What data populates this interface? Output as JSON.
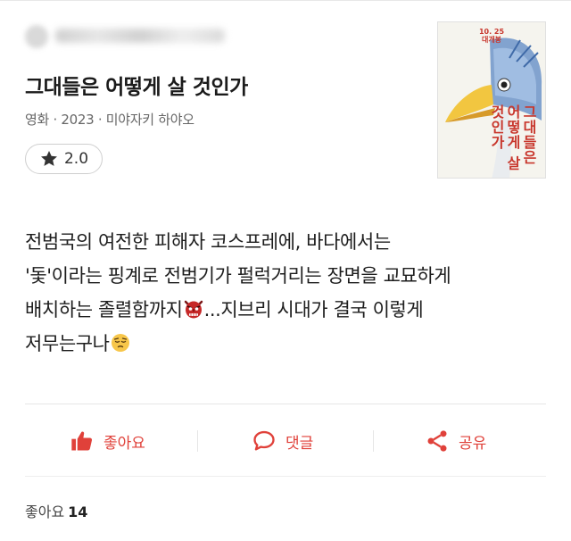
{
  "review": {
    "title": "그대들은 어떻게 살 것인가",
    "meta": "영화 · 2023 · 미야자키 하야오",
    "rating": "2.0",
    "body_lines": [
      "전범국의 여전한 피해자 코스프레에, 바다에서는",
      "'돛'이라는 핑계로 전범기가 펄럭거리는 장면을 교묘하게",
      "배치하는 졸렬함까지",
      "...지브리 시대가 결국 이렇게",
      "저무는구나"
    ],
    "poster": {
      "date_line1": "10. 25",
      "date_line2": "대개봉",
      "title_vertical": "그대들은 어떻게 살것인가"
    }
  },
  "actions": {
    "like_label": "좋아요",
    "comment_label": "댓글",
    "share_label": "공유"
  },
  "likes": {
    "label": "좋아요",
    "count": "14"
  },
  "colors": {
    "accent": "#e0413a",
    "text": "#1d1d1d",
    "muted": "#666666"
  },
  "icons": {
    "rating": "star-icon",
    "like": "thumbs-up-icon",
    "comment": "speech-bubble-icon",
    "share": "share-icon",
    "emoji_1": "goblin-mask-emoji",
    "emoji_2": "pensive-face-emoji"
  }
}
